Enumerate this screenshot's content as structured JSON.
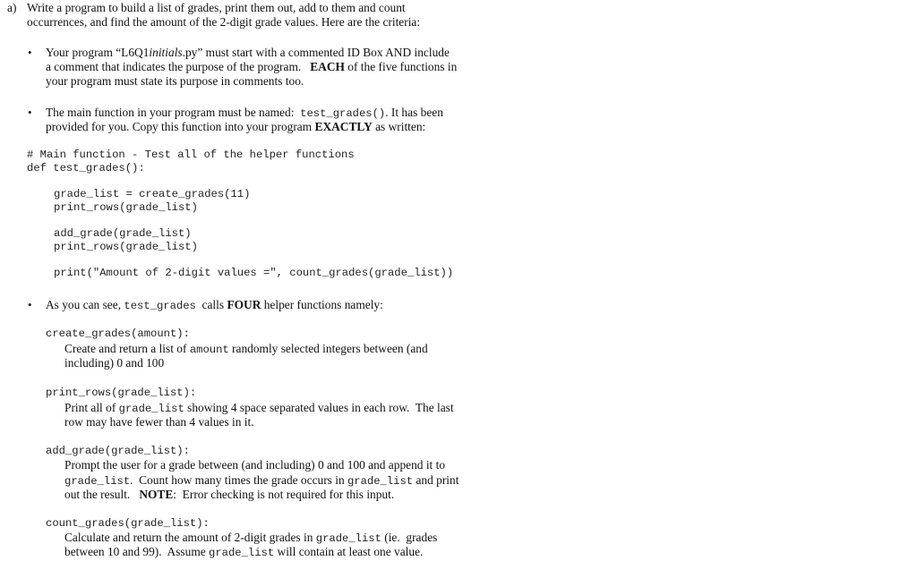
{
  "question": {
    "label": "a)",
    "intro_line1": "Write a program to build a list of grades, print them out, add to them and count",
    "intro_line2": "occurrences, and find the amount of the 2-digit grade values.  Here are the criteria:"
  },
  "bullet1": {
    "line1_pre": "Your program “L6Q1",
    "line1_ital": "initials",
    "line1_post": ".py” must start with a commented ID Box AND include",
    "line2_pre": "a comment that indicates the purpose of the program.   ",
    "line2_bold": "EACH",
    "line2_post": " of the five functions in",
    "line3": "your program must state its purpose in comments too."
  },
  "bullet2": {
    "line1_pre": "The main function in your program must be named:  ",
    "line1_code": "test_grades()",
    "line1_post": ". It has been",
    "line2_pre": "provided for you.  Copy this function into your program ",
    "line2_bold": "EXACTLY",
    "line2_post": " as written:"
  },
  "code_block": {
    "comment": "# Main function - Test all of the helper functions",
    "def_line": "def test_grades():",
    "body": [
      "grade_list = create_grades(11)",
      "print_rows(grade_list)",
      "add_grade(grade_list)",
      "print_rows(grade_list)",
      "print(\"Amount of 2-digit values =\", count_grades(grade_list))"
    ]
  },
  "bullet3": {
    "pre": "As you can see, ",
    "code": "test_grades",
    "mid": "  calls ",
    "bold": "FOUR",
    "post": " helper functions namely:"
  },
  "helpers": [
    {
      "signature": "create_grades(amount):",
      "desc_line1_pre": "Create and return a list of ",
      "desc_line1_code": "amount",
      "desc_line1_post": " randomly selected integers between (and",
      "desc_line2": "including) 0 and 100"
    },
    {
      "signature": "print_rows(grade_list):",
      "desc_line1_pre": "Print all of ",
      "desc_line1_code": "grade_list",
      "desc_line1_post": " showing 4 space separated values in each row.  The last",
      "desc_line2": "row may have fewer than 4 values in it."
    },
    {
      "signature": "add_grade(grade_list):",
      "desc_line1": "Prompt the user for a grade between (and including) 0 and 100 and append it to",
      "desc_line2_code1": "grade_list",
      "desc_line2_mid": ".  Count how many times the grade occurs in ",
      "desc_line2_code2": "grade_list",
      "desc_line2_post": " and print",
      "desc_line3_pre": "out the result.   ",
      "desc_line3_bold": "NOTE",
      "desc_line3_post": ":  Error checking is not required for this input."
    },
    {
      "signature": "count_grades(grade_list):",
      "desc_line1_pre": "Calculate and return the amount of 2-digit grades in ",
      "desc_line1_code": "grade_list",
      "desc_line1_post": " (ie.  grades",
      "desc_line2_pre": "between 10 and 99).  Assume ",
      "desc_line2_code": "grade_list",
      "desc_line2_post": " will contain at least one value."
    }
  ],
  "bullet_glyph": "•"
}
